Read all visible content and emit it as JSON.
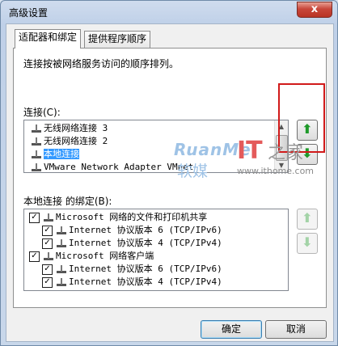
{
  "window": {
    "title": "高级设置",
    "close_glyph": "x"
  },
  "tabs": [
    {
      "label": "适配器和绑定",
      "active": true
    },
    {
      "label": "提供程序顺序",
      "active": false
    }
  ],
  "description": "连接按被网络服务访问的顺序排列。",
  "connections": {
    "label": "连接(C):",
    "items": [
      {
        "text": "无线网络连接 3",
        "selected": false
      },
      {
        "text": "无线网络连接 2",
        "selected": false
      },
      {
        "text": "本地连接",
        "selected": true
      },
      {
        "text": "VMware Network Adapter VMnet",
        "selected": false
      }
    ]
  },
  "bindings": {
    "label": "本地连接 的绑定(B):",
    "items": [
      {
        "text": "Microsoft 网络的文件和打印机共享",
        "checked": true,
        "level": 0,
        "icon": "network-service-icon"
      },
      {
        "text": "Internet 协议版本 6 (TCP/IPv6)",
        "checked": true,
        "level": 1,
        "icon": "protocol-icon"
      },
      {
        "text": "Internet 协议版本 4 (TCP/IPv4)",
        "checked": true,
        "level": 1,
        "icon": "protocol-icon"
      },
      {
        "text": "Microsoft 网络客户端",
        "checked": true,
        "level": 0,
        "icon": "network-client-icon"
      },
      {
        "text": "Internet 协议版本 6 (TCP/IPv6)",
        "checked": true,
        "level": 1,
        "icon": "protocol-icon"
      },
      {
        "text": "Internet 协议版本 4 (TCP/IPv4)",
        "checked": true,
        "level": 1,
        "icon": "protocol-icon"
      }
    ]
  },
  "arrows": {
    "up": "⬆",
    "down": "⬇"
  },
  "buttons": {
    "ok": "确定",
    "cancel": "取消"
  },
  "watermark": {
    "brand": "RuanMei",
    "brand_cn": "软媒",
    "it_logo": "IT",
    "it_cn": "之家",
    "url": "www.ithome.com"
  },
  "colors": {
    "selection": "#3399ff",
    "arrow_green": "#1f9a2a",
    "highlight_box": "#d11a1a"
  }
}
